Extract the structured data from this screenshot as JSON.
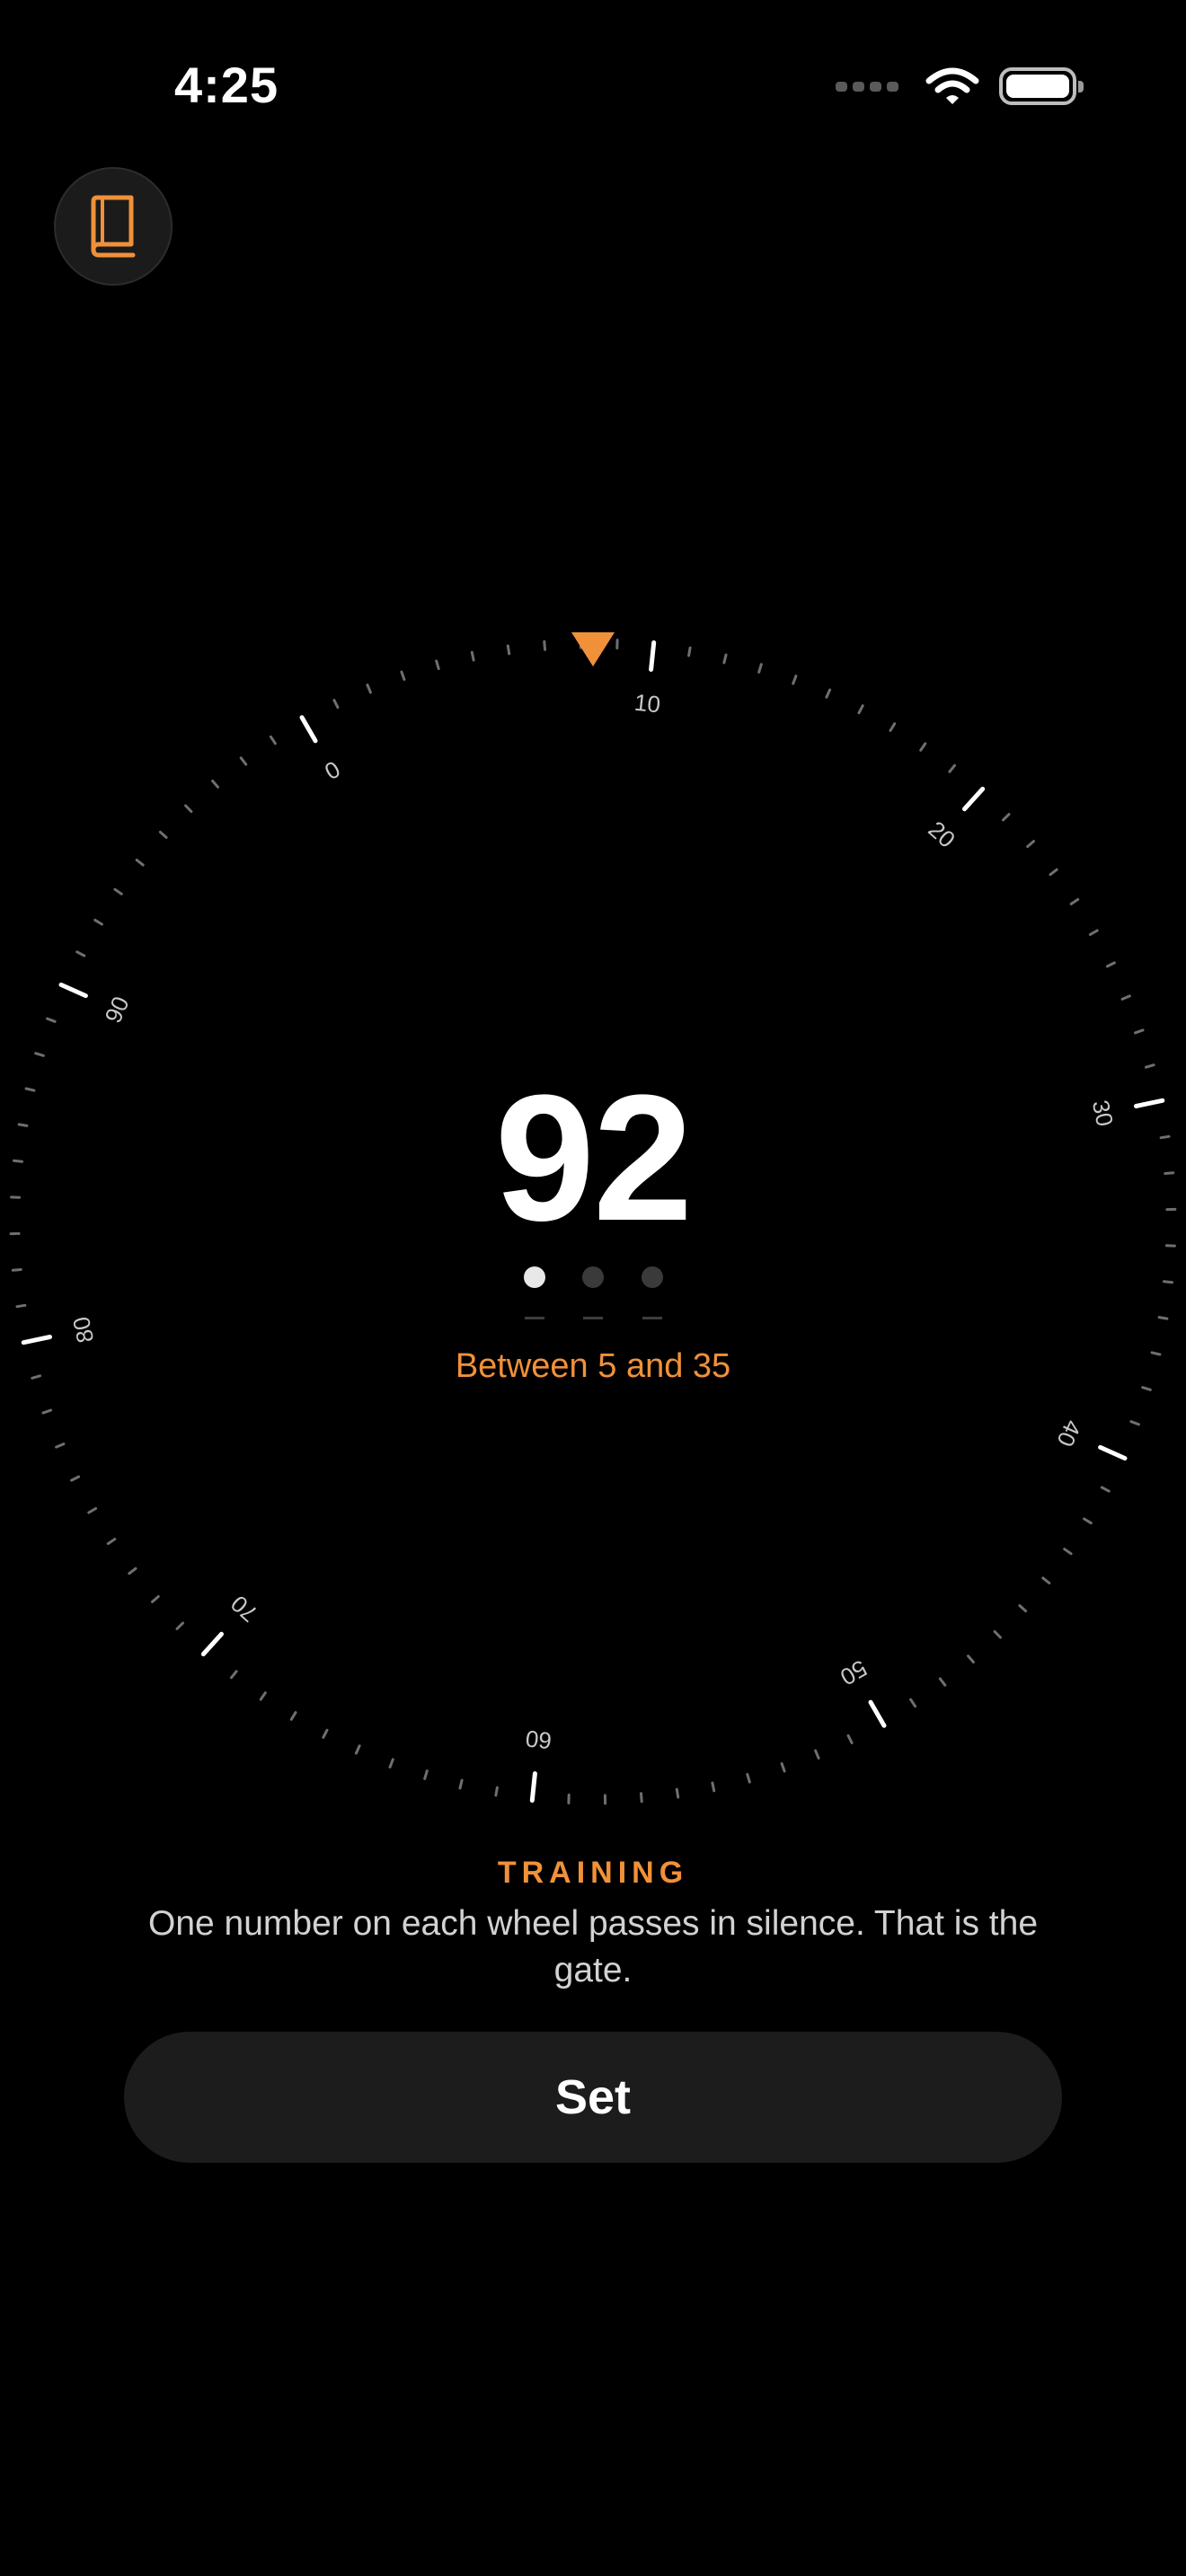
{
  "status_bar": {
    "time": "4:25"
  },
  "icons": {
    "guide": "book-icon",
    "wifi": "wifi-icon",
    "battery": "battery-icon",
    "signal": "cellular-signal-icon",
    "pointer": "pointer-triangle-icon"
  },
  "colors": {
    "accent": "#F0913A",
    "background": "#000000",
    "button": "#1C1C1C",
    "tick": "#8A8A8A"
  },
  "dial": {
    "current_value": "92",
    "min": 0,
    "max": 99,
    "labels": [
      "0",
      "10",
      "20",
      "30",
      "40",
      "50",
      "60",
      "70",
      "80",
      "90"
    ]
  },
  "progress": {
    "total_wheels": 3,
    "current_wheel": 1
  },
  "hint": "Between 5 and 35",
  "training": {
    "label": "TRAINING",
    "text": "One number on each wheel passes in silence. That is the gate."
  },
  "set_button": {
    "label": "Set"
  }
}
